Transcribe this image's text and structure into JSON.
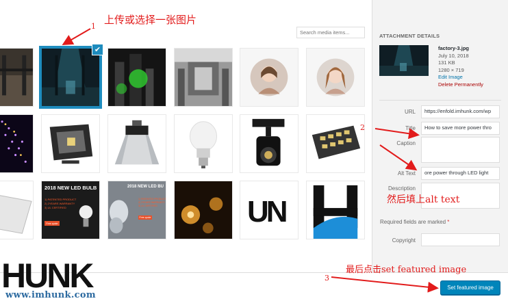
{
  "search": {
    "placeholder": "Search media items..."
  },
  "attachment": {
    "heading": "ATTACHMENT DETAILS",
    "filename": "factory-3.jpg",
    "date": "July 10, 2018",
    "size": "131 KB",
    "dimensions": "1280 × 719",
    "edit_link": "Edit Image",
    "delete_link": "Delete Permanently"
  },
  "fields": {
    "url_label": "URL",
    "url_value": "https://enfold.imhunk.com/wp",
    "title_label": "Title",
    "title_value": "How to save more power thro",
    "caption_label": "Caption",
    "caption_value": "",
    "alt_label": "Alt Text",
    "alt_value": "ore power through LED light",
    "description_label": "Description",
    "description_value": "",
    "required_note": "Required fields are marked",
    "required_star": "*",
    "copyright_label": "Copyright",
    "copyright_value": ""
  },
  "thumbs_text": {
    "ad_heading": "2018 NEW LED BULB",
    "ad_heading_small": "2018 NEW LED BU",
    "ad_line1": "1) PATENTED PRODUCT",
    "ad_line2": "2) 2YEARS WARRANTY",
    "ad_line3": "3) UL CERTIFIED",
    "ad_button": "Free quote",
    "brand_un": "UN"
  },
  "button": {
    "set_featured": "Set featured image"
  },
  "annotations": {
    "step1": "上传或选择一张图片",
    "step2": "然后填上alt text",
    "step3": "最后点击set featured image",
    "num1": "1",
    "num2": "2",
    "num3": "3"
  },
  "logo": {
    "text": "HUNK",
    "url": "www.imhunk.com"
  },
  "colors": {
    "accent": "#0085ba",
    "selection": "#1e8cbe",
    "annotation": "#e21b1b",
    "delete": "#aa0000"
  }
}
